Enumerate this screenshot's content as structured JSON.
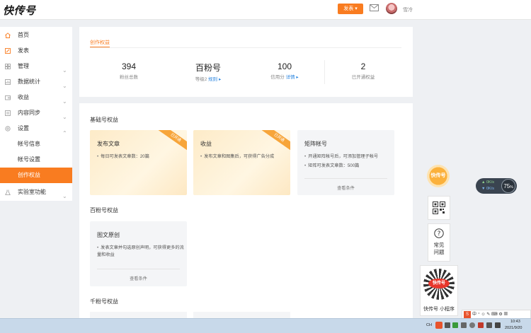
{
  "header": {
    "logo": "快传号",
    "publish_label": "发表 ▾",
    "username": "雪冷"
  },
  "sidebar": {
    "items": [
      {
        "label": "首页",
        "icon": "home-icon"
      },
      {
        "label": "发表",
        "icon": "edit-icon"
      },
      {
        "label": "管理",
        "icon": "grid-icon"
      },
      {
        "label": "数据统计",
        "icon": "chart-icon"
      },
      {
        "label": "收益",
        "icon": "wallet-icon"
      },
      {
        "label": "内容同步",
        "icon": "sync-icon"
      },
      {
        "label": "设置",
        "icon": "gear-icon"
      },
      {
        "label": "帐号信息"
      },
      {
        "label": "帐号设置"
      },
      {
        "label": "创作权益"
      },
      {
        "label": "实验室功能",
        "icon": "flask-icon"
      }
    ]
  },
  "tabs": {
    "active": "创作权益"
  },
  "stats": [
    {
      "value": "394",
      "label": "粉丝总数"
    },
    {
      "value": "百粉号",
      "label": "等级2",
      "link": "规则 ▸"
    },
    {
      "value": "100",
      "label": "信用分",
      "link": "详情 ▸"
    },
    {
      "value": "2",
      "label": "已开通权益"
    }
  ],
  "sections": {
    "basic": "基础号权益",
    "hundred": "百粉号权益",
    "thousand": "千粉号权益"
  },
  "benefits": {
    "publish": {
      "title": "发布文章",
      "ribbon": "已开通",
      "lines": [
        "每日可发表文章数：20篇"
      ]
    },
    "income": {
      "title": "收益",
      "ribbon": "已开通",
      "lines": [
        "发布文章和图集后，可获得广告分成"
      ]
    },
    "matrix": {
      "title": "矩阵帐号",
      "lines": [
        "开通矩阵帐号后，可添加管理子帐号",
        "矩阵可发表文章数：500篇"
      ],
      "cond": "查看条件"
    },
    "original": {
      "title": "图文原创",
      "lines": [
        "发表文章并勾选原创声明，可获得更多的流量和收益"
      ],
      "cond": "查看条件"
    }
  },
  "floating": {
    "badge": "快传号",
    "help": [
      "常见",
      "问题"
    ],
    "miniprogram": "快传号 小程序",
    "qr_badge": "快传号"
  },
  "speed": {
    "up": "0K/s",
    "down": "0K/s",
    "percent": "75",
    "pct_unit": "%"
  },
  "taskbar": {
    "lang": "CH",
    "time": "10:43",
    "date": "2021/9/20"
  }
}
